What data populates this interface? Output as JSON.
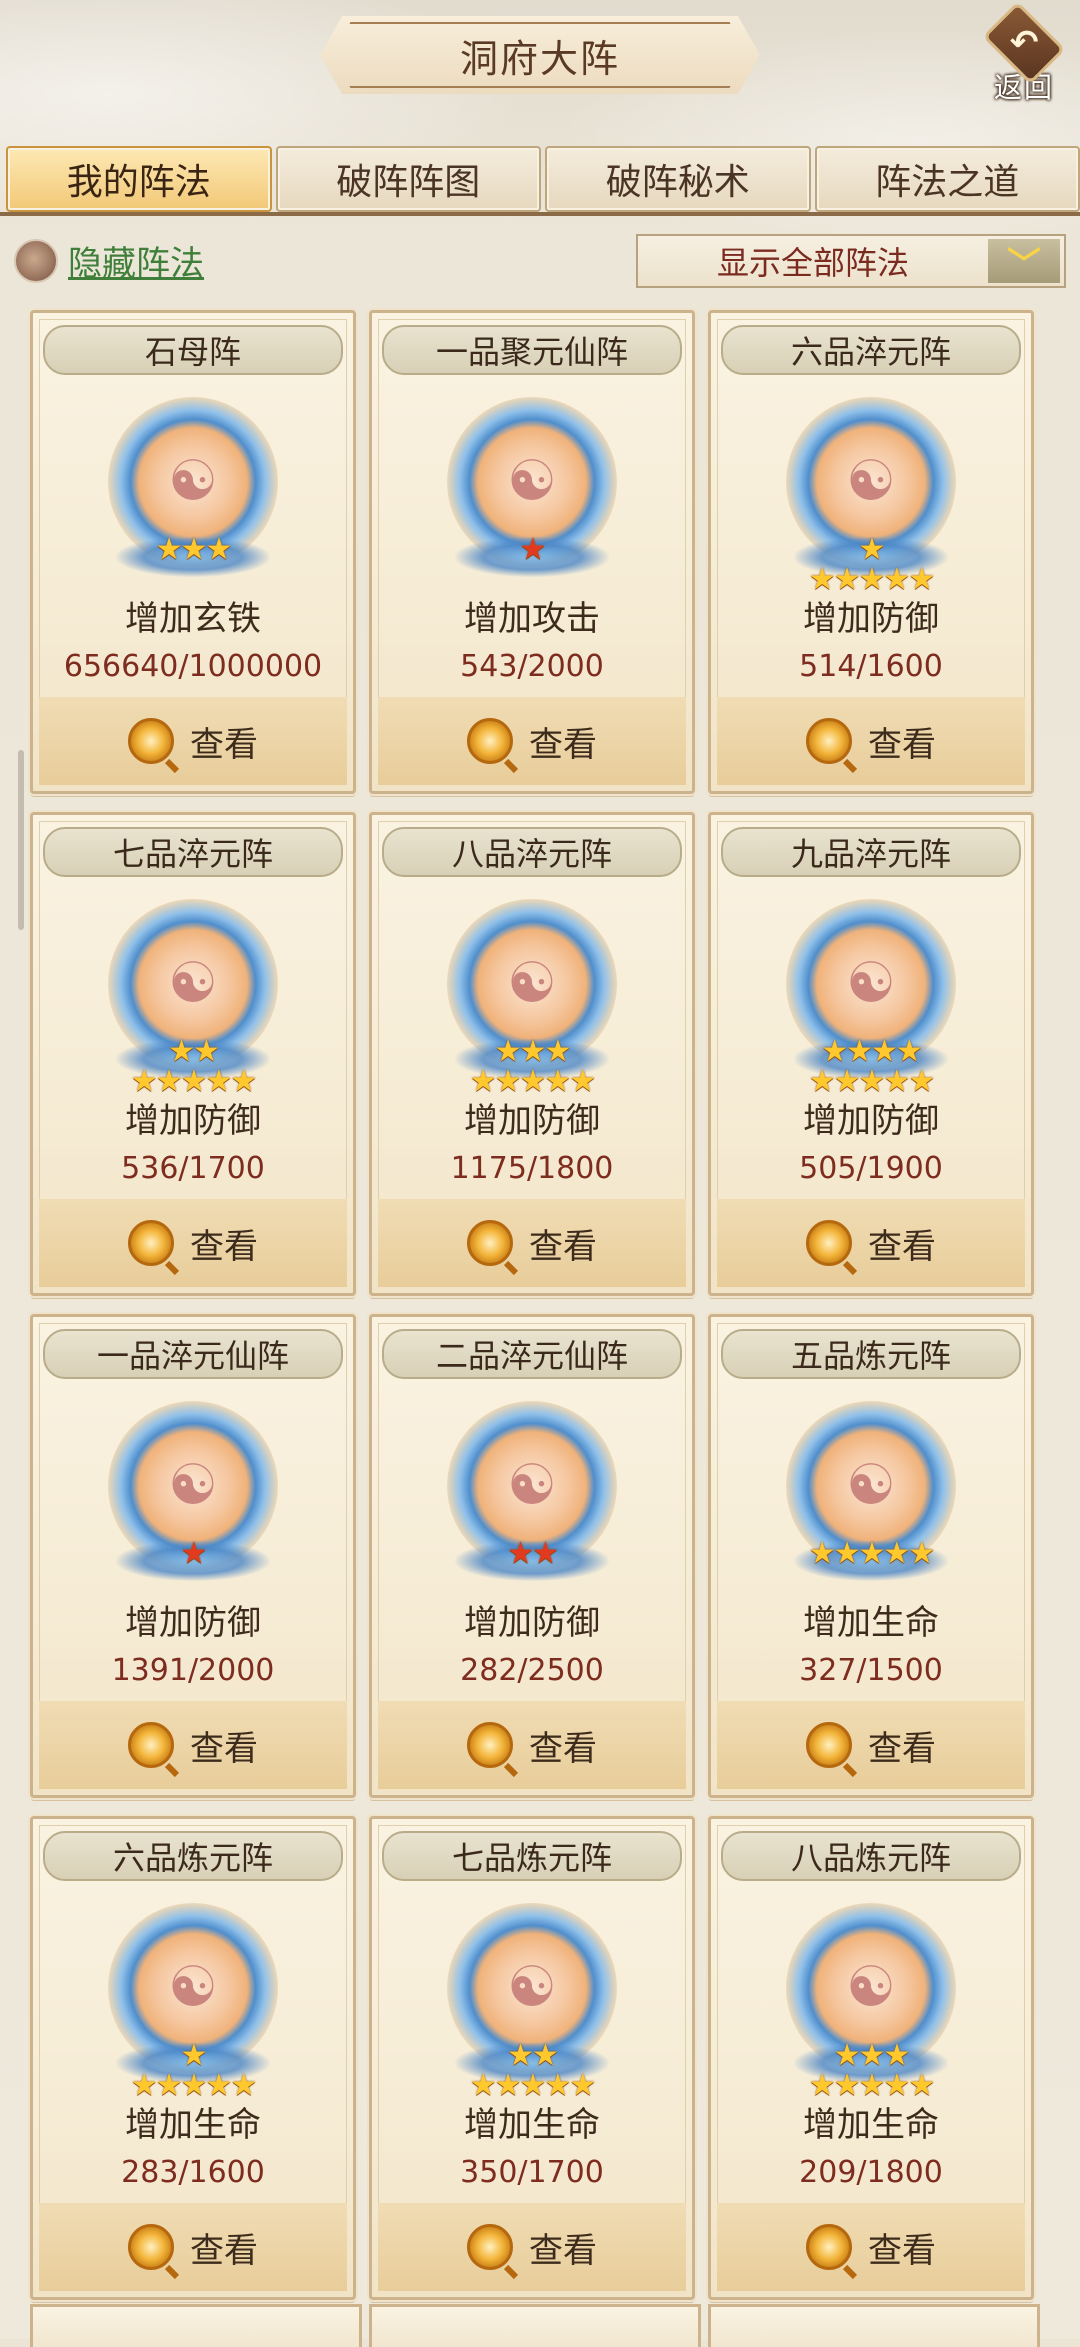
{
  "header": {
    "title": "洞府大阵",
    "back_label": "返回"
  },
  "tabs": [
    {
      "label": "我的阵法",
      "active": true
    },
    {
      "label": "破阵阵图",
      "active": false
    },
    {
      "label": "破阵秘术",
      "active": false
    },
    {
      "label": "阵法之道",
      "active": false
    }
  ],
  "filters": {
    "hide_label": "隐藏阵法",
    "dropdown_value": "显示全部阵法",
    "dropdown_arrow": "﹀"
  },
  "view_label": "查看",
  "taiji_glyph": "☯",
  "cards": [
    {
      "name": "石母阵",
      "effect": "增加玄铁",
      "progress": "656640/1000000",
      "star_rows": [
        {
          "glyph": "★★★",
          "color": "gold"
        }
      ]
    },
    {
      "name": "一品聚元仙阵",
      "effect": "增加攻击",
      "progress": "543/2000",
      "star_rows": [
        {
          "glyph": "★",
          "color": "red"
        }
      ]
    },
    {
      "name": "六品淬元阵",
      "effect": "增加防御",
      "progress": "514/1600",
      "star_rows": [
        {
          "glyph": "★",
          "color": "gold"
        },
        {
          "glyph": "★★★★★",
          "color": "gold"
        }
      ]
    },
    {
      "name": "七品淬元阵",
      "effect": "增加防御",
      "progress": "536/1700",
      "star_rows": [
        {
          "glyph": "★★",
          "color": "gold"
        },
        {
          "glyph": "★★★★★",
          "color": "gold"
        }
      ]
    },
    {
      "name": "八品淬元阵",
      "effect": "增加防御",
      "progress": "1175/1800",
      "star_rows": [
        {
          "glyph": "★★★",
          "color": "gold"
        },
        {
          "glyph": "★★★★★",
          "color": "gold"
        }
      ]
    },
    {
      "name": "九品淬元阵",
      "effect": "增加防御",
      "progress": "505/1900",
      "star_rows": [
        {
          "glyph": "★★★★",
          "color": "gold"
        },
        {
          "glyph": "★★★★★",
          "color": "gold"
        }
      ]
    },
    {
      "name": "一品淬元仙阵",
      "effect": "增加防御",
      "progress": "1391/2000",
      "star_rows": [
        {
          "glyph": "★",
          "color": "red"
        }
      ]
    },
    {
      "name": "二品淬元仙阵",
      "effect": "增加防御",
      "progress": "282/2500",
      "star_rows": [
        {
          "glyph": "★★",
          "color": "red"
        }
      ]
    },
    {
      "name": "五品炼元阵",
      "effect": "增加生命",
      "progress": "327/1500",
      "star_rows": [
        {
          "glyph": "★★★★★",
          "color": "gold"
        }
      ]
    },
    {
      "name": "六品炼元阵",
      "effect": "增加生命",
      "progress": "283/1600",
      "star_rows": [
        {
          "glyph": "★",
          "color": "gold"
        },
        {
          "glyph": "★★★★★",
          "color": "gold"
        }
      ]
    },
    {
      "name": "七品炼元阵",
      "effect": "增加生命",
      "progress": "350/1700",
      "star_rows": [
        {
          "glyph": "★★",
          "color": "gold"
        },
        {
          "glyph": "★★★★★",
          "color": "gold"
        }
      ]
    },
    {
      "name": "八品炼元阵",
      "effect": "增加生命",
      "progress": "209/1800",
      "star_rows": [
        {
          "glyph": "★★★",
          "color": "gold"
        },
        {
          "glyph": "★★★★★",
          "color": "gold"
        }
      ]
    }
  ],
  "colors": {
    "accent_tab": "#f2c877",
    "hide_link": "#3f7f3a",
    "progress_text": "#7e2c1f",
    "star_gold": "#ffc82c",
    "star_red": "#e23a1f"
  }
}
